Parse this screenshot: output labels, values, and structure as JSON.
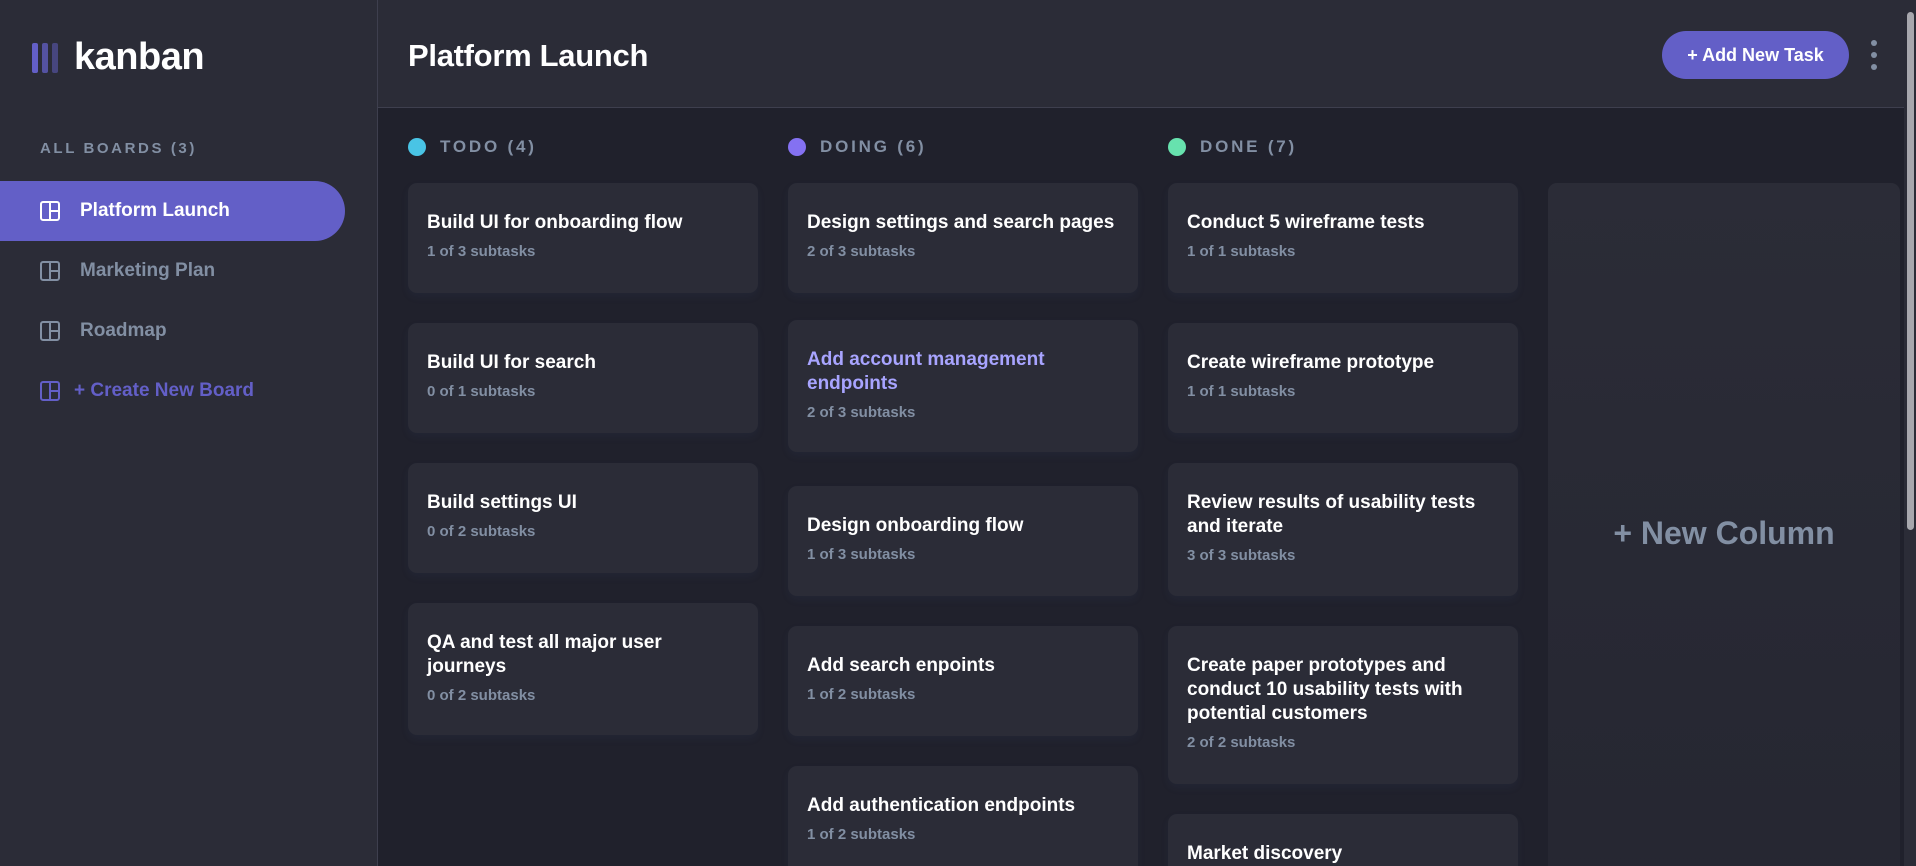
{
  "app": {
    "name": "kanban"
  },
  "sidebar": {
    "heading": "ALL BOARDS (3)",
    "boards": [
      {
        "label": "Platform Launch",
        "active": true
      },
      {
        "label": "Marketing Plan",
        "active": false
      },
      {
        "label": "Roadmap",
        "active": false
      }
    ],
    "create_label": "+ Create New Board"
  },
  "header": {
    "title": "Platform Launch",
    "add_task_label": "+ Add New Task"
  },
  "columns": [
    {
      "heading": "TODO (4)",
      "dot_color": "#49c4e5",
      "cards": [
        {
          "title": "Build UI for onboarding flow",
          "subtasks": "1 of 3 subtasks"
        },
        {
          "title": "Build UI for search",
          "subtasks": "0 of 1 subtasks"
        },
        {
          "title": "Build settings UI",
          "subtasks": "0 of 2 subtasks"
        },
        {
          "title": "QA and test all major user journeys",
          "subtasks": "0 of 2 subtasks"
        }
      ]
    },
    {
      "heading": "DOING (6)",
      "dot_color": "#8471f2",
      "cards": [
        {
          "title": "Design settings and search pages",
          "subtasks": "2 of 3 subtasks"
        },
        {
          "title": "Add account management endpoints",
          "subtasks": "2 of 3 subtasks"
        },
        {
          "title": "Design onboarding flow",
          "subtasks": "1 of 3 subtasks"
        },
        {
          "title": "Add search enpoints",
          "subtasks": "1 of 2 subtasks"
        },
        {
          "title": "Add authentication endpoints",
          "subtasks": "1 of 2 subtasks"
        }
      ]
    },
    {
      "heading": "DONE (7)",
      "dot_color": "#67e2ae",
      "cards": [
        {
          "title": "Conduct 5 wireframe tests",
          "subtasks": "1 of 1 subtasks"
        },
        {
          "title": "Create wireframe prototype",
          "subtasks": "1 of 1 subtasks"
        },
        {
          "title": "Review results of usability tests and iterate",
          "subtasks": "3 of 3 subtasks"
        },
        {
          "title": "Create paper prototypes and conduct 10 usability tests with potential customers",
          "subtasks": "2 of 2 subtasks"
        },
        {
          "title": "Market discovery",
          "subtasks": ""
        }
      ]
    }
  ],
  "new_column_label": "+ New Column",
  "colors": {
    "accent": "#635fc7",
    "background": "#20212c",
    "surface": "#2b2c37",
    "muted_text": "#828fa3"
  }
}
